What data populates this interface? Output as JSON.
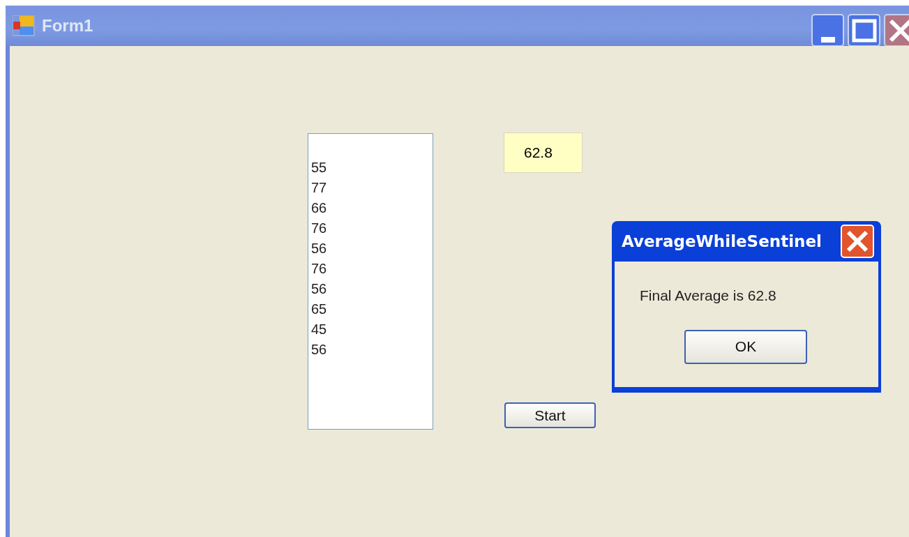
{
  "window": {
    "title": "Form1"
  },
  "listbox": {
    "items": [
      "55",
      "77",
      "66",
      "76",
      "56",
      "76",
      "56",
      "65",
      "45",
      "56"
    ]
  },
  "result_field": {
    "value": "62.8"
  },
  "start_button": {
    "label": "Start"
  },
  "dialog": {
    "title": "AverageWhileSentinel",
    "message": "Final Average is 62.8",
    "ok_button": "OK"
  }
}
